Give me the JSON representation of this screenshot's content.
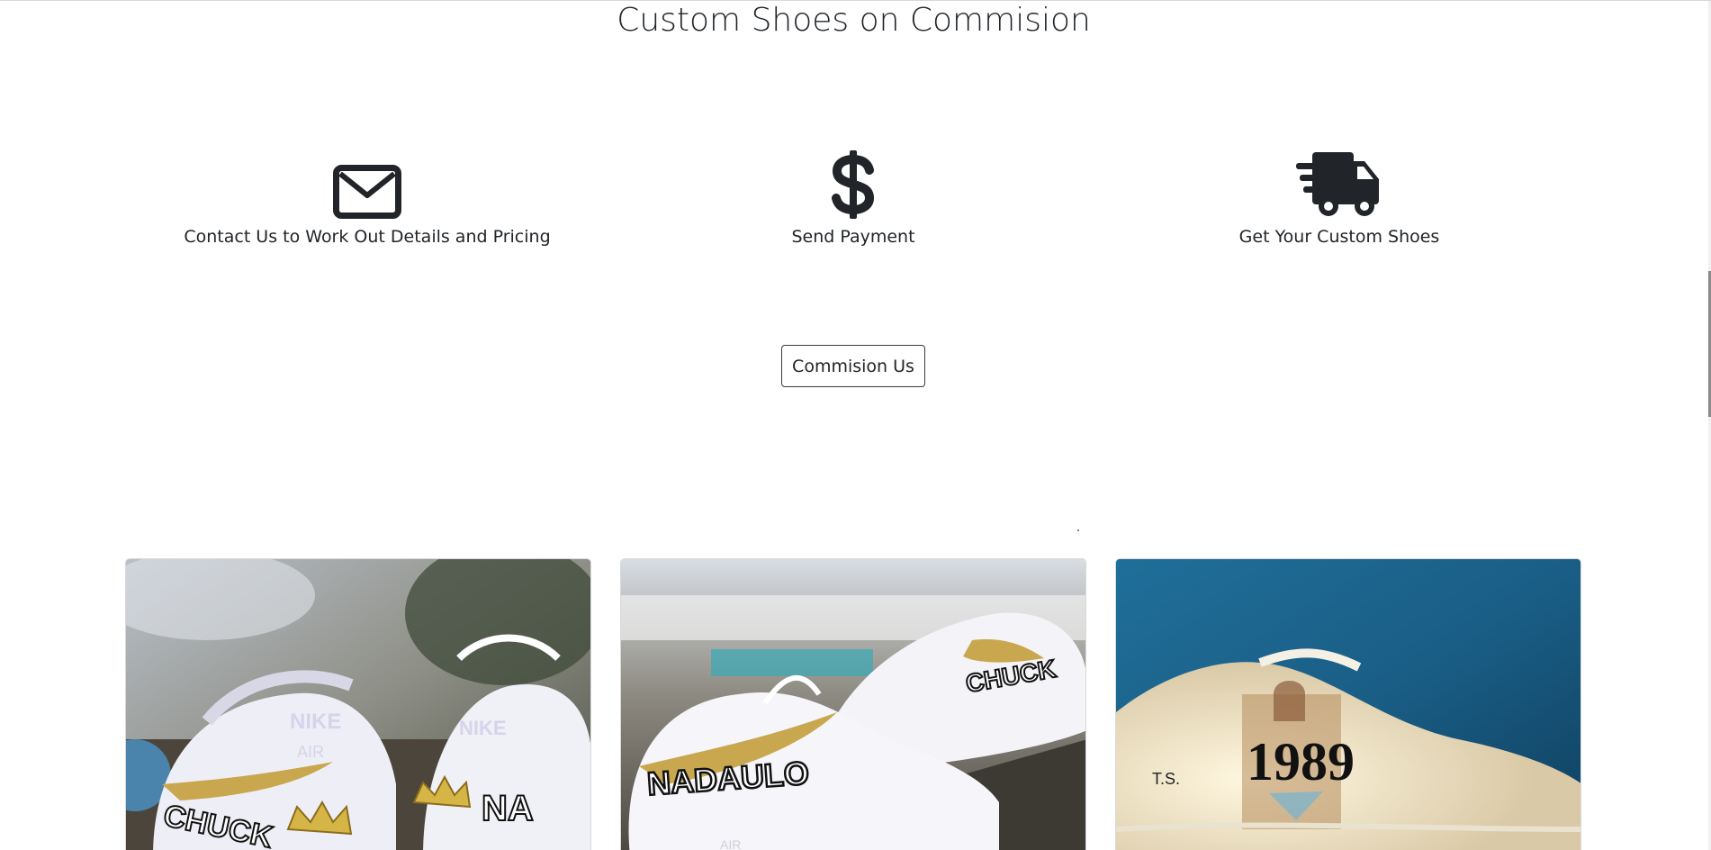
{
  "header": {
    "title": "Custom Shoes on Commision"
  },
  "steps": [
    {
      "icon": "envelope-icon",
      "label": "Contact Us to Work Out Details and Pricing"
    },
    {
      "icon": "dollar-icon",
      "label": "Send Payment"
    },
    {
      "icon": "shipping-fast-icon",
      "label": "Get Your Custom Shoes"
    }
  ],
  "cta": {
    "label": "Commision Us"
  },
  "gallery": {
    "images": [
      {
        "name": "custom-shoe-photo-1",
        "text": [
          "NIKE",
          "AIR",
          "CHUCK"
        ]
      },
      {
        "name": "custom-shoe-photo-2",
        "text": [
          "NADAULO",
          "CHUCK",
          "AIR"
        ]
      },
      {
        "name": "custom-shoe-photo-3",
        "text": [
          "1989",
          "T.S."
        ]
      }
    ]
  },
  "colors": {
    "text": "#212529",
    "button_border": "#343a40",
    "gold": "#c9a74e"
  }
}
